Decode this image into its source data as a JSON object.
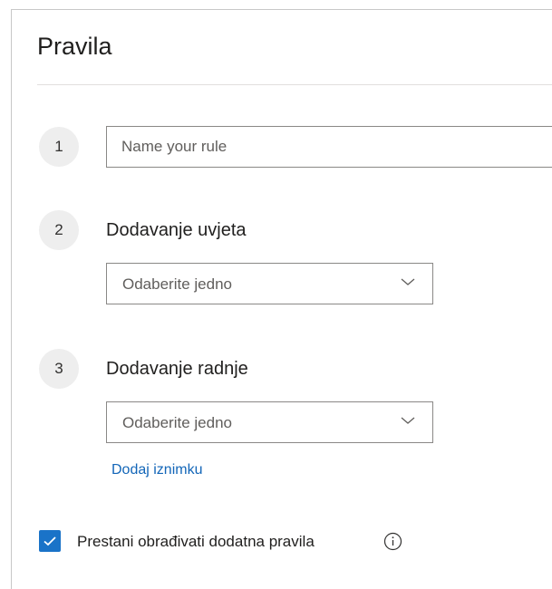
{
  "panel": {
    "title": "Pravila"
  },
  "steps": [
    {
      "number": "1",
      "input_placeholder": "Name your rule",
      "input_value": ""
    },
    {
      "number": "2",
      "label": "Dodavanje uvjeta",
      "dropdown_value": "Odaberite jedno"
    },
    {
      "number": "3",
      "label": "Dodavanje radnje",
      "dropdown_value": "Odaberite jedno"
    }
  ],
  "add_exception_link": "Dodaj iznimku",
  "stop_processing": {
    "label": "Prestani obrađivati dodatna pravila",
    "checked": true
  },
  "icons": {
    "checkbox": "checkmark-icon",
    "dropdown": "chevron-down-icon",
    "info": "info-icon"
  },
  "colors": {
    "accent": "#1a73c8",
    "link": "#1366b8",
    "step_circle": "#eeeeee"
  }
}
